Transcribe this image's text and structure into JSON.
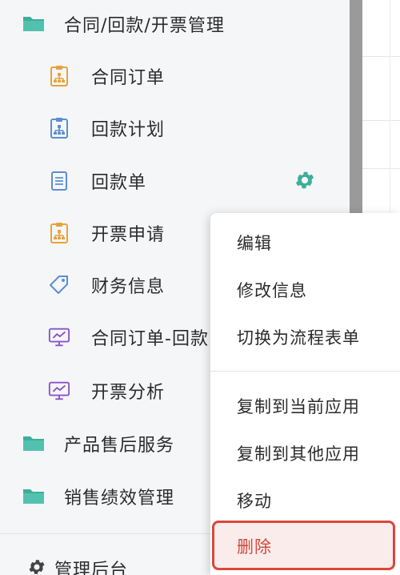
{
  "sidebar": {
    "folders": [
      {
        "label": "合同/回款/开票管理"
      },
      {
        "label": "产品售后服务"
      },
      {
        "label": "销售绩效管理"
      }
    ],
    "children": [
      {
        "label": "合同订单",
        "icon": "clipboard-org-icon",
        "color": "#e8a33c"
      },
      {
        "label": "回款计划",
        "icon": "clipboard-org-icon",
        "color": "#5b8ed6"
      },
      {
        "label": "回款单",
        "icon": "document-icon",
        "color": "#5b8ed6"
      },
      {
        "label": "开票申请",
        "icon": "clipboard-org-icon",
        "color": "#e8a33c"
      },
      {
        "label": "财务信息",
        "icon": "tag-icon",
        "color": "#5b8ed6"
      },
      {
        "label": "合同订单-回款",
        "icon": "monitor-chart-icon",
        "color": "#8b54c9"
      },
      {
        "label": "开票分析",
        "icon": "monitor-chart-icon",
        "color": "#8b54c9"
      }
    ],
    "admin_label": "管理后台"
  },
  "context_menu": {
    "items": [
      {
        "label": "编辑"
      },
      {
        "label": "修改信息"
      },
      {
        "label": "切换为流程表单"
      },
      {
        "label": "复制到当前应用"
      },
      {
        "label": "复制到其他应用"
      },
      {
        "label": "移动"
      },
      {
        "label": "删除"
      }
    ]
  },
  "colors": {
    "folder": "#3dae9b",
    "gear": "#3dae9b",
    "danger": "#d14a3c"
  }
}
